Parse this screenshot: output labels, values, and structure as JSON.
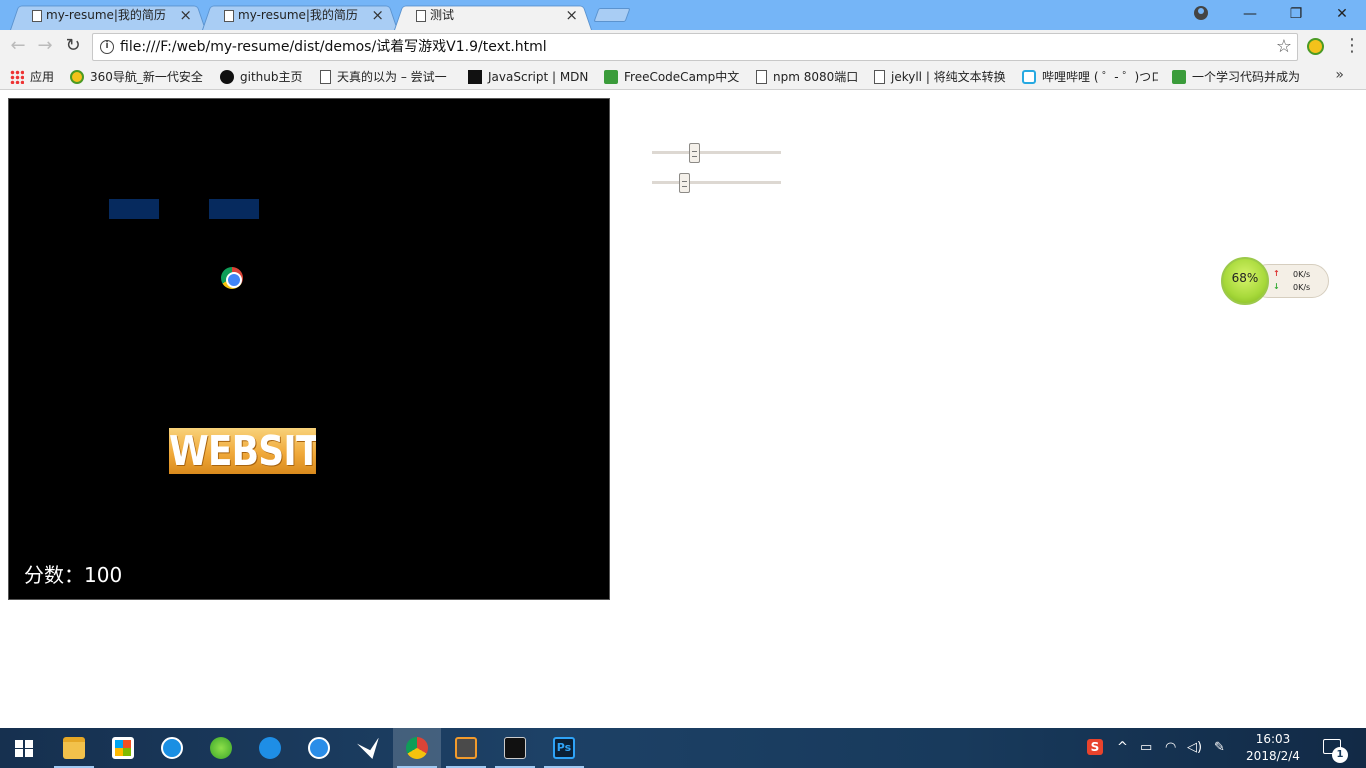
{
  "browser": {
    "tabs": [
      {
        "title": "my-resume|我的简历",
        "active": false
      },
      {
        "title": "my-resume|我的简历",
        "active": false
      },
      {
        "title": "测试",
        "active": true
      }
    ],
    "close_glyph": "×",
    "url": "file:///F:/web/my-resume/dist/demos/试着写游戏V1.9/text.html",
    "window_controls": {
      "minimize": "—",
      "restore": "❐",
      "close": "✕"
    }
  },
  "bookmarks": [
    {
      "label": "应用",
      "icon": "apps-icon"
    },
    {
      "label": "360导航_新一代安全",
      "icon": "nav360-icon"
    },
    {
      "label": "github主页",
      "icon": "github-icon"
    },
    {
      "label": "天真的以为 – 尝试一",
      "icon": "page-icon"
    },
    {
      "label": "JavaScript | MDN",
      "icon": "mdn-icon"
    },
    {
      "label": "FreeCodeCamp中文",
      "icon": "fcc-icon"
    },
    {
      "label": "npm 8080端口",
      "icon": "page-icon"
    },
    {
      "label": "jekyll | 将纯文本转换",
      "icon": "page-icon"
    },
    {
      "label": "哔哩哔哩 ( ゜- ゜)つロ",
      "icon": "bilibili-icon"
    },
    {
      "label": "一个学习代码并成为",
      "icon": "fcc-icon"
    }
  ],
  "game": {
    "bricks": 2,
    "paddle_text": "WEBSITE",
    "score_label": "分数：100",
    "colors": {
      "background": "#000000",
      "brick": "#062a5e"
    }
  },
  "sliders": [
    {
      "name": "slider-1",
      "fraction": 0.31
    },
    {
      "name": "slider-2",
      "fraction": 0.23
    }
  ],
  "net_monitor": {
    "percent": "68%",
    "upload": "0K/s",
    "download": "0K/s"
  },
  "taskbar": {
    "apps": [
      "start",
      "file-explorer",
      "store",
      "kugou",
      "360-browser",
      "edge",
      "media-player",
      "feishu-bird",
      "chrome",
      "sublime-text",
      "terminal",
      "photoshop"
    ],
    "tray": {
      "ime": "S",
      "up_arrow": "^"
    },
    "clock": {
      "time": "16:03",
      "date": "2018/2/4"
    },
    "notification_count": "1"
  }
}
